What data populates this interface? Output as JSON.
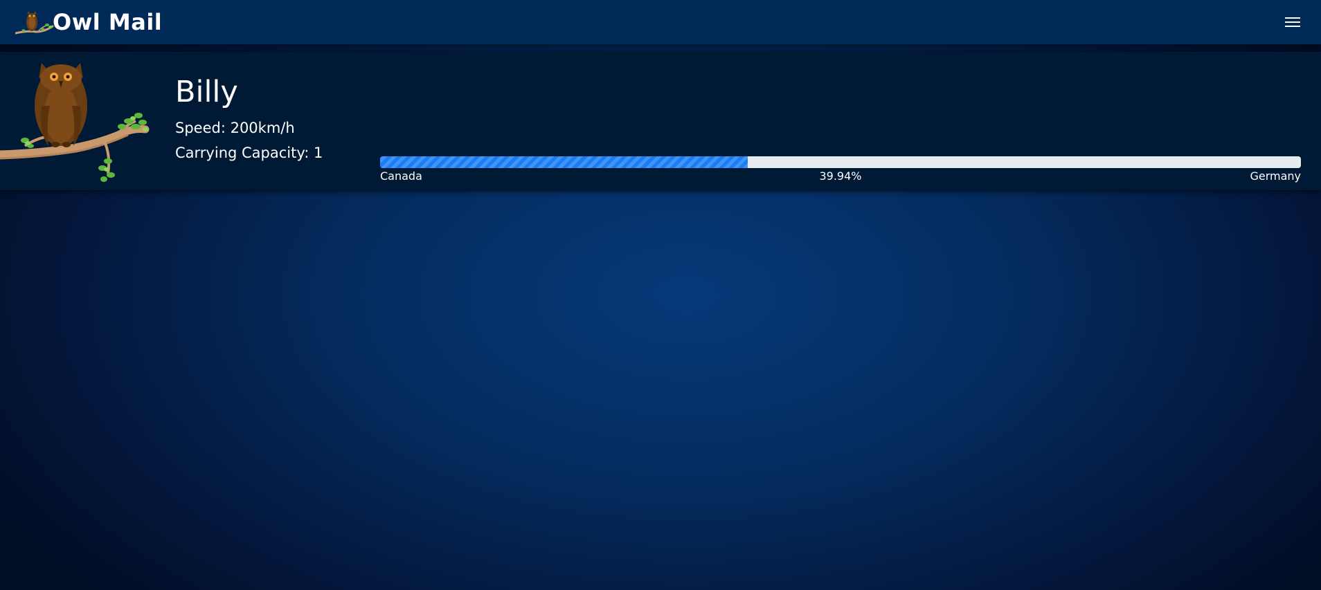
{
  "app": {
    "title": "Owl Mail",
    "logo_icon": "owl-on-branch-icon",
    "menu_icon": "hamburger-menu-icon"
  },
  "owl": {
    "name": "Billy",
    "speed_text": "Speed: 200km/h",
    "capacity_text": "Carrying Capacity: 1",
    "image_icon": "owl-on-branch-illustration",
    "journey": {
      "origin": "Canada",
      "destination": "Germany",
      "progress_percent": 39.94,
      "progress_text": "39.94%"
    }
  },
  "colors": {
    "navbar": "#002957",
    "card": "#001a36",
    "progress_fill": "#1a7df5",
    "progress_track": "#e9ecef",
    "text": "#ffffff"
  }
}
